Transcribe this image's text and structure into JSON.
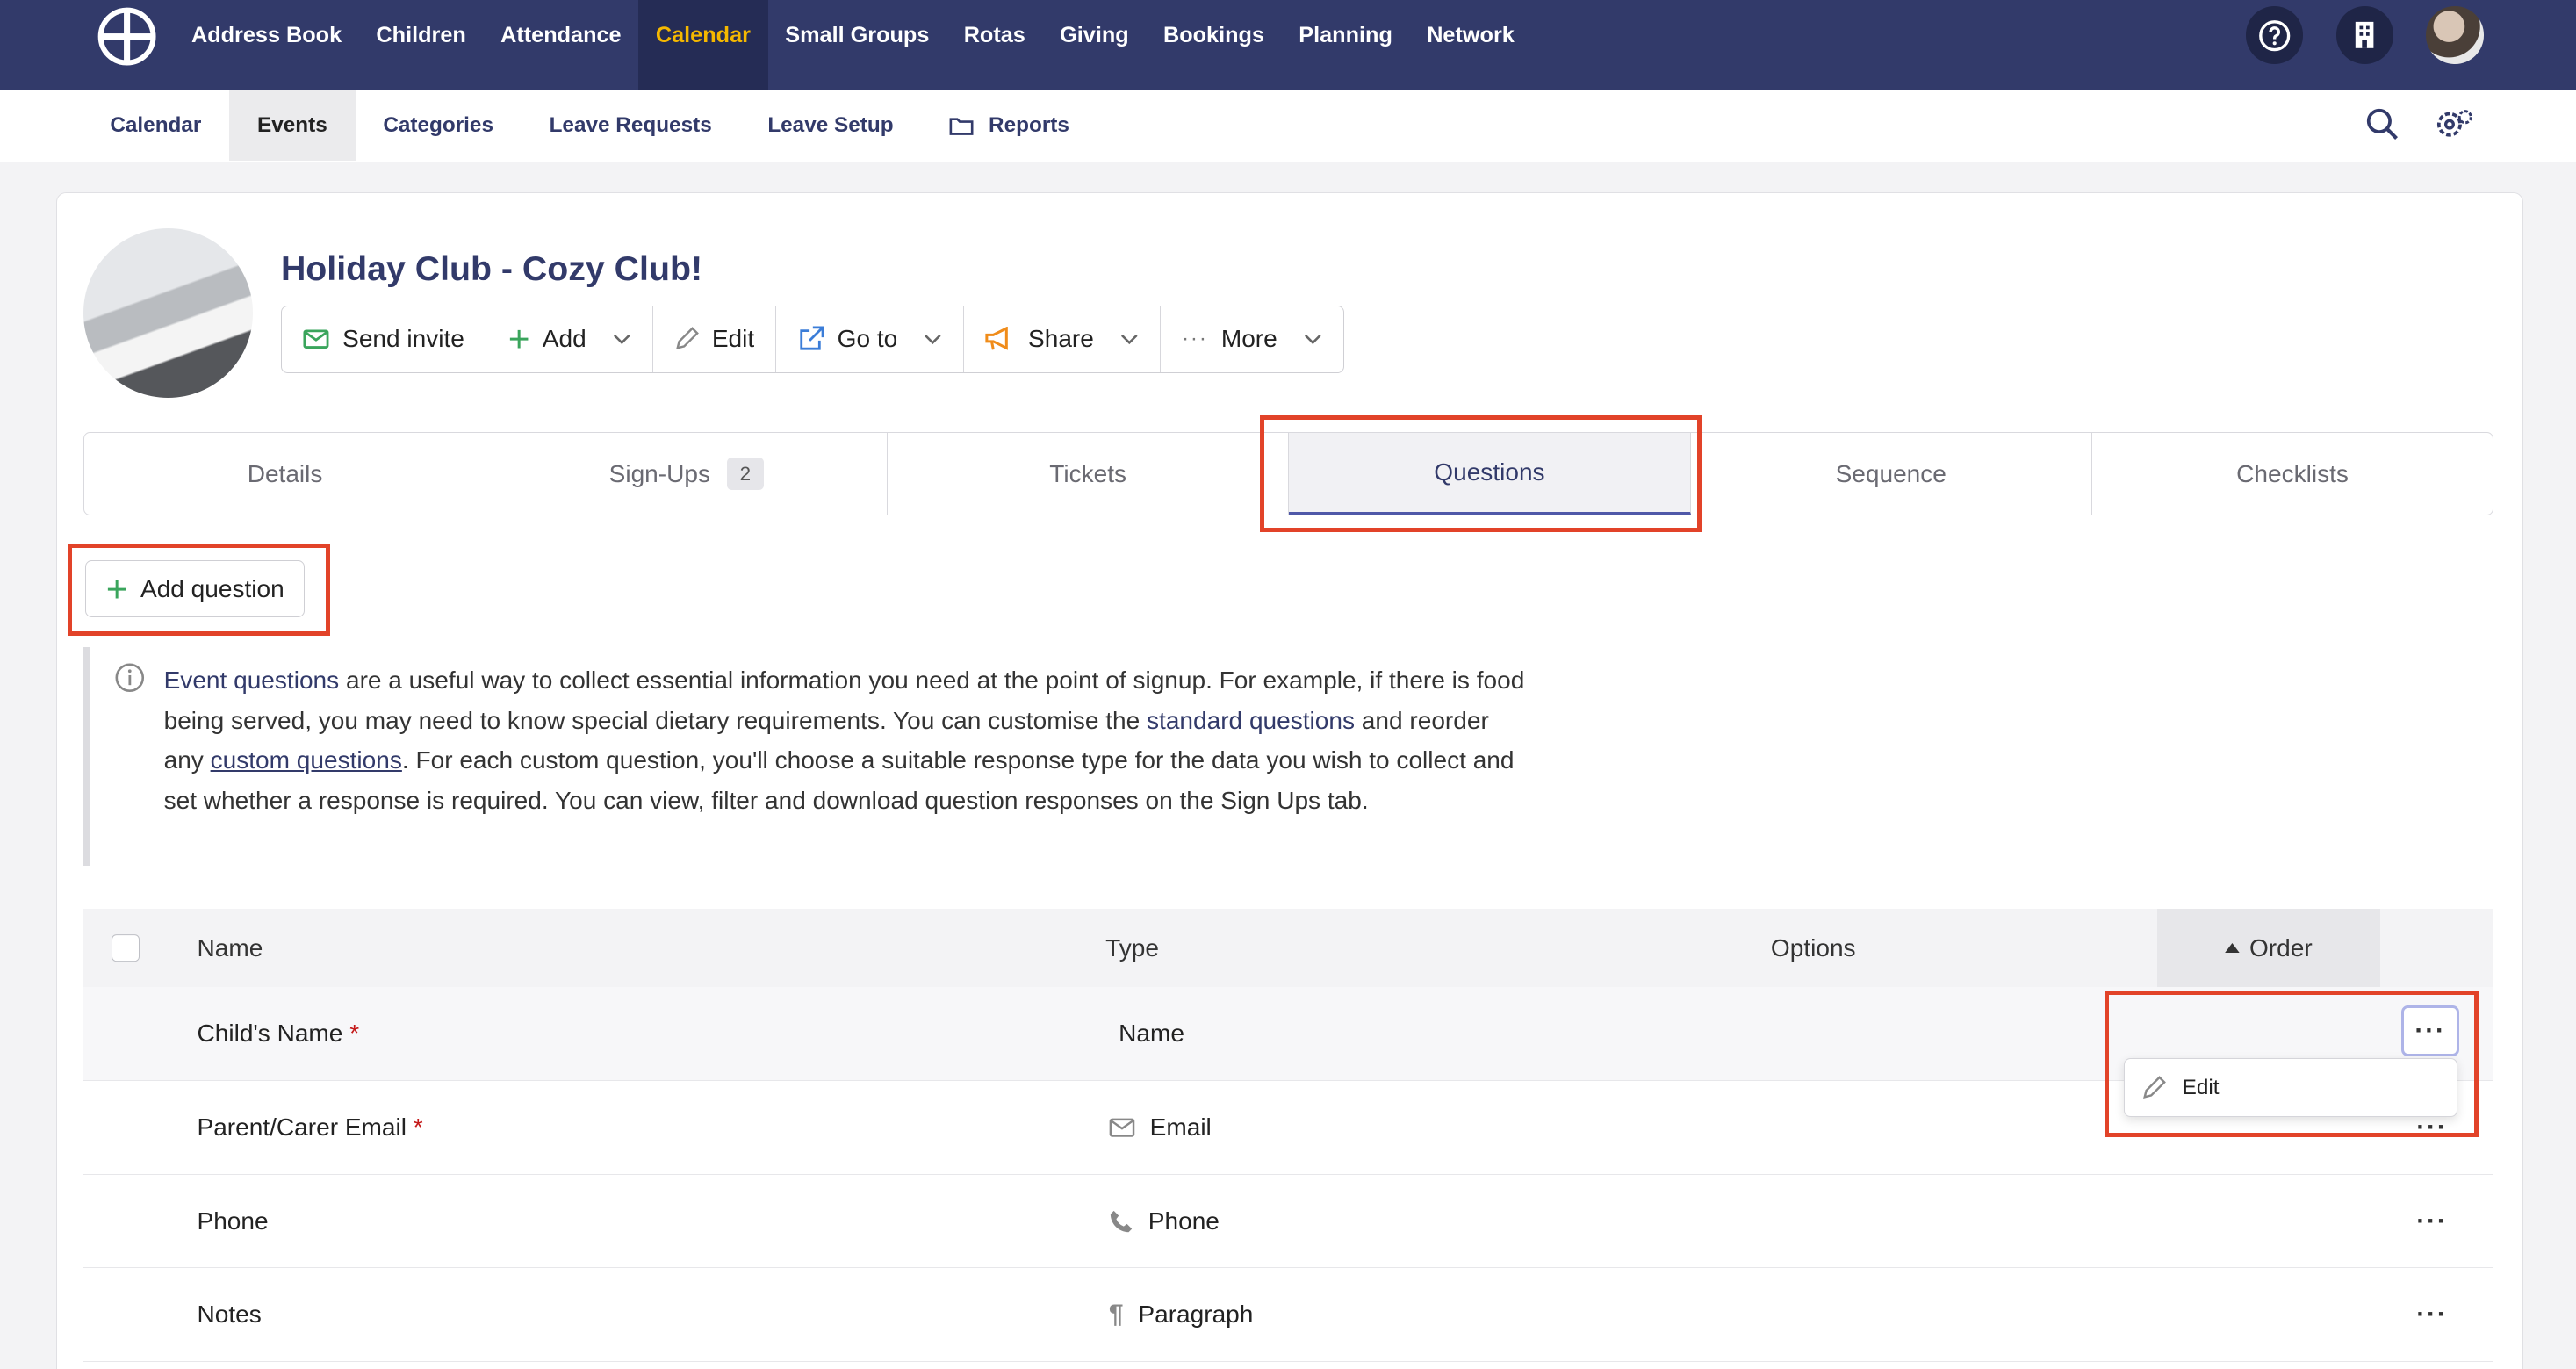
{
  "topnav": {
    "items": [
      "Address Book",
      "Children",
      "Attendance",
      "Calendar",
      "Small Groups",
      "Rotas",
      "Giving",
      "Bookings",
      "Planning",
      "Network"
    ],
    "active_index": 3
  },
  "subnav": {
    "items": [
      "Calendar",
      "Events",
      "Categories",
      "Leave Requests",
      "Leave Setup",
      "Reports"
    ],
    "active_index": 1
  },
  "event": {
    "title": "Holiday Club - Cozy Club!",
    "actions": {
      "send_invite": "Send invite",
      "add": "Add",
      "edit": "Edit",
      "go_to": "Go to",
      "share": "Share",
      "more": "More"
    }
  },
  "tabs": {
    "details": "Details",
    "signups": "Sign-Ups",
    "signups_count": "2",
    "tickets": "Tickets",
    "questions": "Questions",
    "sequence": "Sequence",
    "checklists": "Checklists"
  },
  "add_question_label": "Add question",
  "info": {
    "link1": "Event questions",
    "text1": " are a useful way to collect essential information you need at the point of signup. For example, if there is food being served, you may need to know special dietary requirements. You can customise the ",
    "link2": "standard questions",
    "text2": " and reorder any ",
    "link3": "custom questions",
    "text3": ". For each custom question, you'll choose a suitable response type for the data you wish to collect and set whether a response is required. You can view, filter and download question responses on the Sign Ups tab."
  },
  "table": {
    "headers": {
      "name": "Name",
      "type": "Type",
      "options": "Options",
      "order": "Order"
    },
    "rows": [
      {
        "name": "Child's Name",
        "required": "*",
        "type": "Name",
        "icon": "none"
      },
      {
        "name": "Parent/Carer Email",
        "required": "*",
        "type": "Email",
        "icon": "envelope-icon"
      },
      {
        "name": "Phone",
        "required": "",
        "type": "Phone",
        "icon": "phone-icon"
      },
      {
        "name": "Notes",
        "required": "",
        "type": "Paragraph",
        "icon": "paragraph-icon"
      }
    ],
    "row_menu": {
      "edit": "Edit"
    }
  },
  "colors": {
    "nav_bg": "#323a6a",
    "active_nav": "#f5b800",
    "highlight": "#e24329",
    "accent_green": "#3aa55c"
  }
}
